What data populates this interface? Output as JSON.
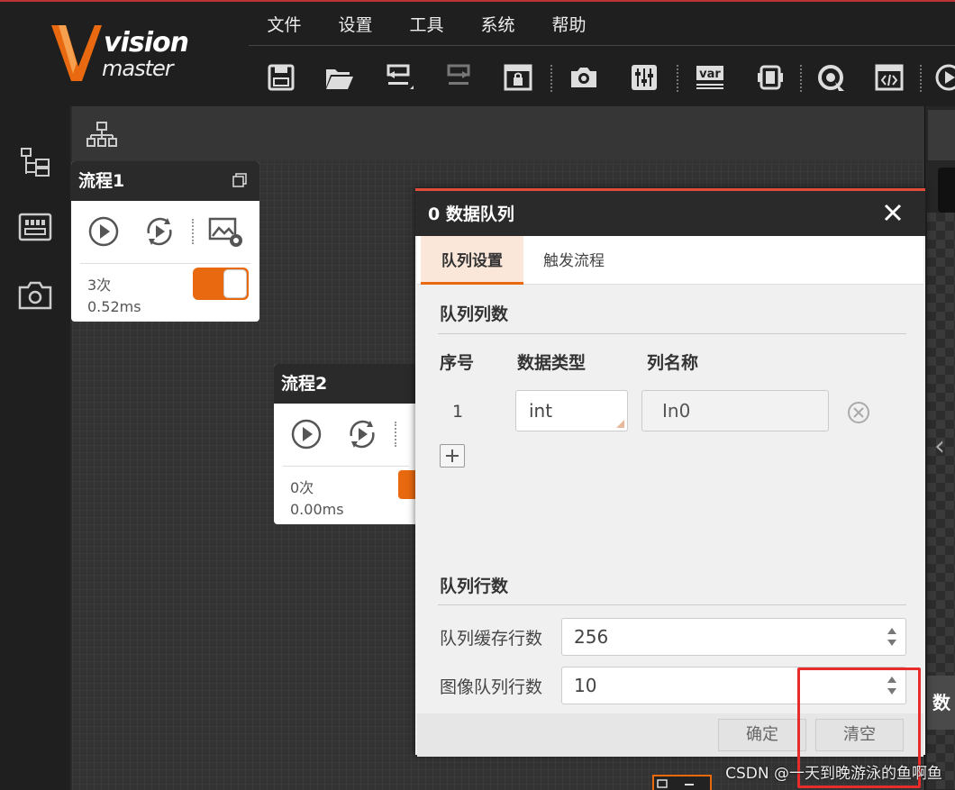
{
  "app": {
    "logo_line1": "vision",
    "logo_line2": "master"
  },
  "menu": [
    "文件",
    "设置",
    "工具",
    "系统",
    "帮助"
  ],
  "toolbar_icons": [
    "save-icon",
    "open-folder-icon",
    "undo-icon",
    "redo-icon",
    "lock-window-icon",
    "camera-icon",
    "controls-icon",
    "var-icon",
    "device-icon",
    "run-once-icon",
    "code-icon",
    "play-icon"
  ],
  "toolbar": {
    "var_label": "var"
  },
  "flows": [
    {
      "title": "流程1",
      "count": "3次",
      "time": "0.52ms"
    },
    {
      "title": "流程2",
      "count": "0次",
      "time": "0.00ms"
    }
  ],
  "right_strip": {
    "label": "数"
  },
  "dialog": {
    "title": "0 数据队列",
    "tabs": [
      "队列设置",
      "触发流程"
    ],
    "queue_columns_title": "队列列数",
    "columns": {
      "index": "序号",
      "data_type": "数据类型",
      "column_name": "列名称"
    },
    "rows": [
      {
        "index": "1",
        "data_type": "int",
        "column_name": "In0"
      }
    ],
    "queue_rows_title": "队列行数",
    "buffer_rows_label": "队列缓存行数",
    "buffer_rows_value": "256",
    "image_rows_label": "图像队列行数",
    "image_rows_value": "10",
    "confirm_label": "确定",
    "clear_label": "清空"
  },
  "watermark": "CSDN @一天到晚游泳的鱼啊鱼",
  "colors": {
    "accent": "#e8690f",
    "dialog_border": "#e24c3a",
    "highlight": "#e82b2b"
  }
}
